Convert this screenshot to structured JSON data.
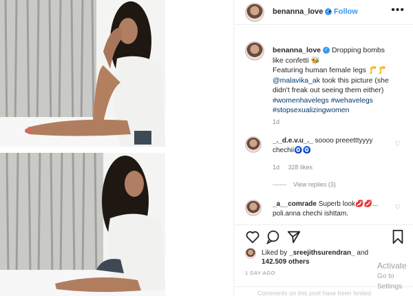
{
  "post": {
    "username": "benanna_love",
    "follow_label": "Follow",
    "more_label": "•••",
    "dot_label": "•"
  },
  "caption": {
    "username": "benanna_love",
    "line1": "Dropping bombs like confetti 🐝",
    "line2": "Featuring human female legs 🦵🦵",
    "mention": "@malavika_ak",
    "line3": "took this picture (she didn't freak out seeing them either)",
    "hashtags": "#womenhavelegs #wehavelegs #stopsexualizingwomen",
    "time": "1d"
  },
  "comments": [
    {
      "username": "_._d.e.v.u_._",
      "text": "soooo preeetttyyyy chechii🧿🧿",
      "time": "1d",
      "likes": "328 likes",
      "view_replies": "View replies (3)"
    },
    {
      "username": "_a__comrade",
      "text": "Superb look💋💋... poli.anna chechi ishttam."
    }
  ],
  "likes": {
    "liked_by_prefix": "Liked by",
    "liked_by_user": "_sreejithsurendran_",
    "and_label": "and",
    "others": "142.509 others"
  },
  "date": "1 DAY AGO",
  "add_comment_placeholder": "Comments on this post have been limited",
  "watermark": {
    "title": "Activate",
    "subtitle": "Go to Settings"
  },
  "colors": {
    "link": "#3897f0",
    "muted": "#8e8e8e",
    "text": "#262626"
  }
}
